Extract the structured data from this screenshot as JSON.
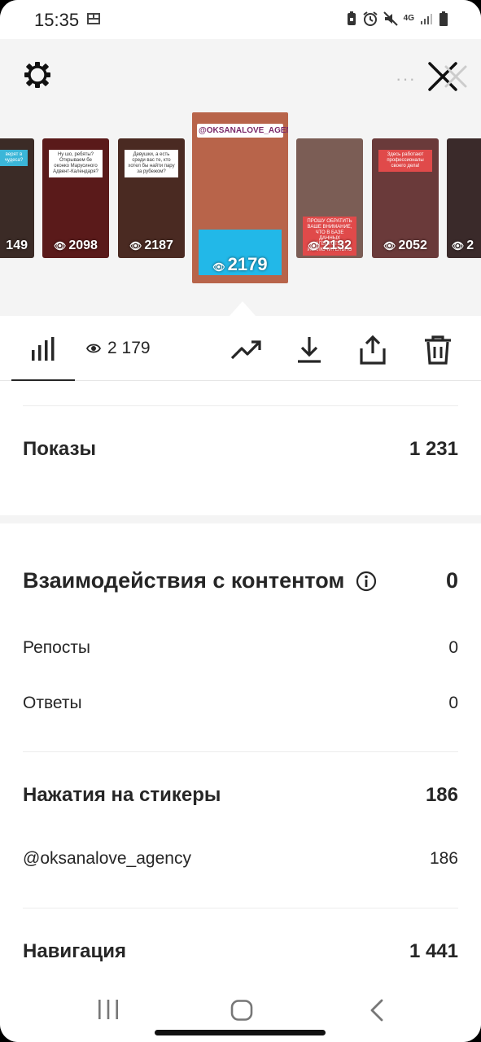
{
  "status_bar": {
    "time": "15:35",
    "network": "4G",
    "icons": [
      "gallery-icon",
      "battery-saver-icon",
      "alarm-icon",
      "mute-icon",
      "signal-icon",
      "battery-icon"
    ]
  },
  "header": {
    "more_label": "···"
  },
  "stories": [
    {
      "views": "149",
      "caption": "верят в чудеса?",
      "bg": "#3b2b26"
    },
    {
      "views": "2098",
      "caption": "Ну шо, ребяты? Открываем бе оконко Марусиного Адвент-Календаря?",
      "bg": "#5a1a1a"
    },
    {
      "views": "2187",
      "caption": "Девушки, а есть среди вас те, кто хотел бы найти пару за рубежом?",
      "bg": "#4a2a22"
    },
    {
      "views": "2179",
      "tag": "@OKSANALOVE_AGENCY",
      "bg": "#b8644a",
      "active": true
    },
    {
      "views": "2132",
      "caption": "ПРОШУ ОБРАТИТЬ ВАШЕ ВНИМАНИЕ, ЧТО В БАЗЕ ДАННЫХ АГЕНТСТВА ИСКЛЮЧИТЕЛЬНО",
      "bg": "#7b5d55"
    },
    {
      "views": "2052",
      "caption": "Здесь работают профессионалы своего дела!",
      "bg": "#6a3a3a"
    },
    {
      "views": "2",
      "caption": "",
      "bg": "#3a2a2a"
    }
  ],
  "toolbar": {
    "views_value": "2 179"
  },
  "metrics": {
    "impressions": {
      "label": "Показы",
      "value": "1 231"
    },
    "interactions": {
      "label": "Взаимодействия с контентом",
      "value": "0"
    },
    "reposts": {
      "label": "Репосты",
      "value": "0"
    },
    "replies": {
      "label": "Ответы",
      "value": "0"
    },
    "sticker_taps": {
      "label": "Нажатия на стикеры",
      "value": "186"
    },
    "sticker_account": {
      "label": "@oksanalove_agency",
      "value": "186"
    },
    "navigation": {
      "label": "Навигация",
      "value": "1 441"
    }
  },
  "colors": {
    "text": "#262626",
    "divider": "#ececec",
    "story_area_bg": "#f4f4f4",
    "active_text_block": "#22b8e8"
  }
}
